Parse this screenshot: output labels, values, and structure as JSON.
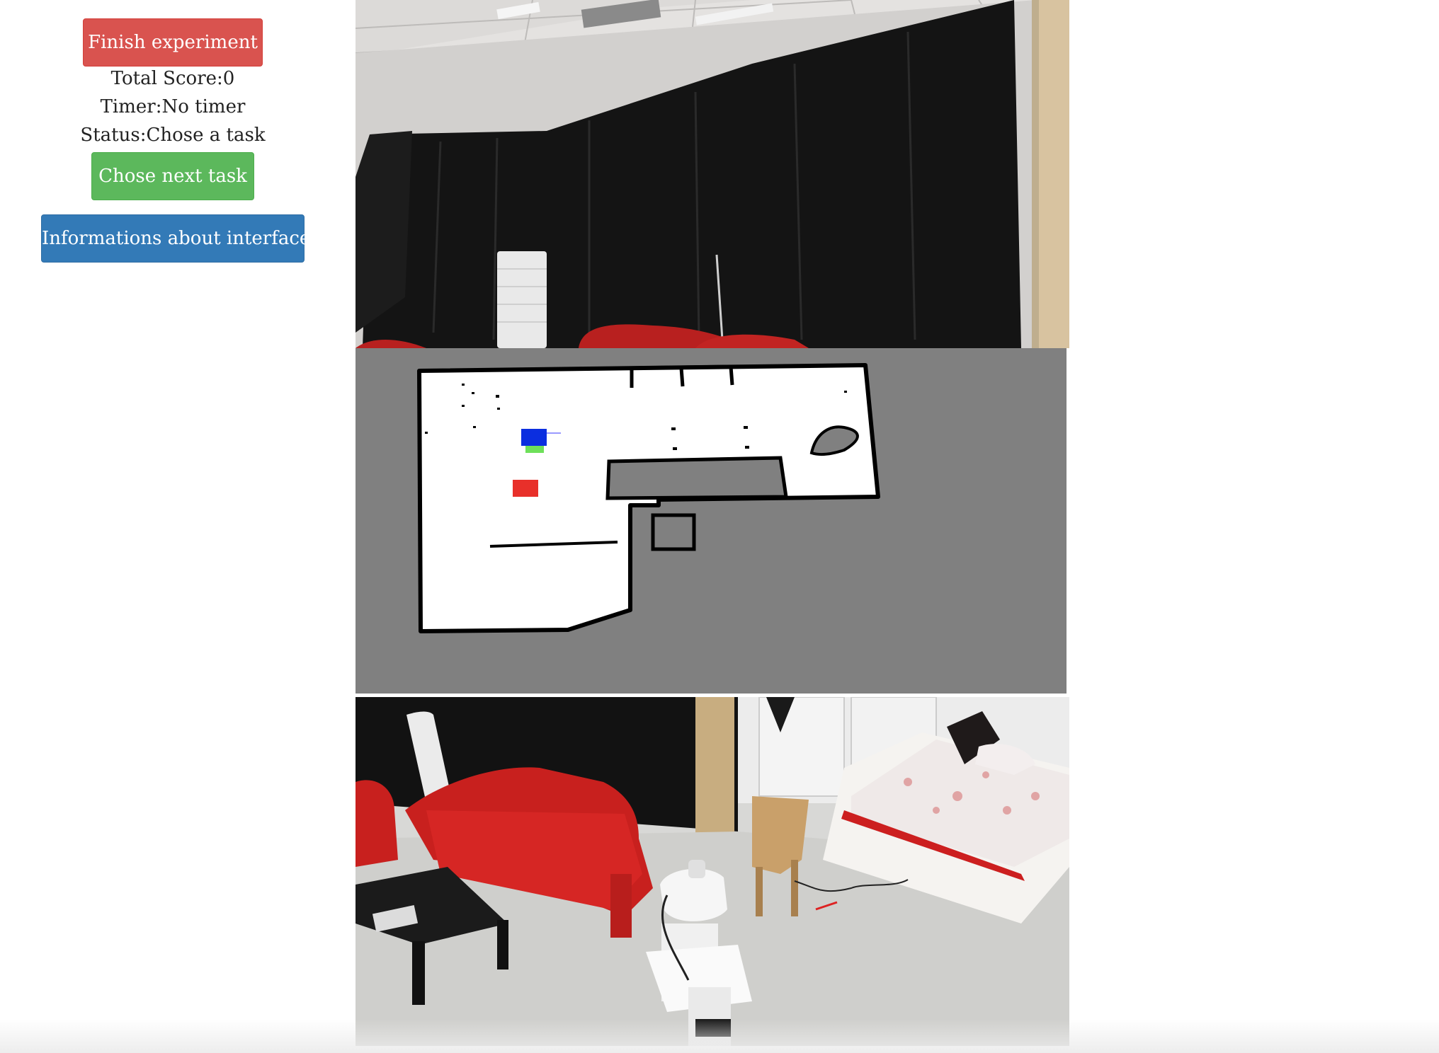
{
  "sidebar": {
    "finish_button": "Finish experiment",
    "score_label": "Total Score:",
    "score_value": "0",
    "timer_label": "Timer:",
    "timer_value": "No timer",
    "status_label": "Status:",
    "status_value": "Chose a task",
    "next_task_button": "Chose next task",
    "info_button": "Informations about interface"
  },
  "colors": {
    "finish": "#d9534f",
    "next_task": "#5cb85c",
    "info": "#337ab7",
    "map_unknown": "#808080",
    "map_free": "#ffffff",
    "robot_marker": "#0b2ee0",
    "goal_marker_green": "#6ee05a",
    "target_marker_red": "#e8302a"
  },
  "panels": {
    "top_camera": "robot-head-camera-feed",
    "map": "occupancy-grid-map",
    "bottom_camera": "room-overview-camera-feed"
  }
}
